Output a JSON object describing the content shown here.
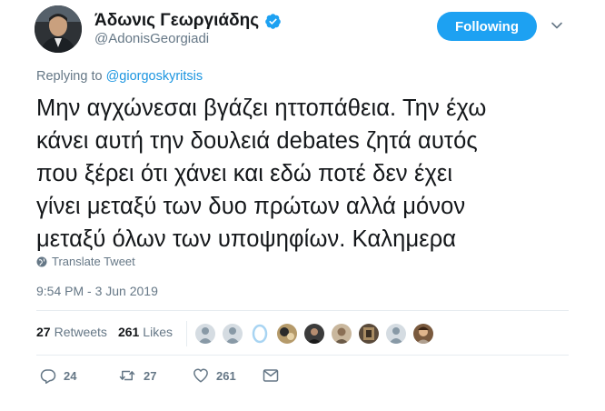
{
  "author": {
    "display_name": "Άδωνις Γεωργιάδης",
    "handle": "@AdonisGeorgiadi"
  },
  "follow_button": {
    "label": "Following"
  },
  "reply": {
    "prefix": "Replying to ",
    "to": "@giorgoskyritsis"
  },
  "tweet": {
    "lines": [
      "Μην αγχώνεσαι βγάζει ηττοπάθεια. Την έχω",
      "κάνει αυτή την δουλειά debates ζητά αυτός",
      "που ξέρει ότι χάνει και εδώ ποτέ δεν έχει",
      "γίνει μεταξύ των δυο πρώτων αλλά μόνον",
      "μεταξύ όλων των υποψηφίων. Καλημερα"
    ]
  },
  "translate_label": "Translate Tweet",
  "timestamp": "9:54 PM - 3 Jun 2019",
  "stats": {
    "retweets_count": "27",
    "retweets_label": "Retweets",
    "likes_count": "261",
    "likes_label": "Likes"
  },
  "actions": {
    "replies": "24",
    "retweets": "27",
    "likes": "261"
  },
  "colors": {
    "accent": "#1da1f2",
    "link": "#1b95e0",
    "muted": "#657786",
    "text": "#14171a"
  },
  "icons": [
    "verified-badge-icon",
    "chevron-down-icon",
    "globe-icon",
    "reply-icon",
    "retweet-icon",
    "like-icon"
  ]
}
